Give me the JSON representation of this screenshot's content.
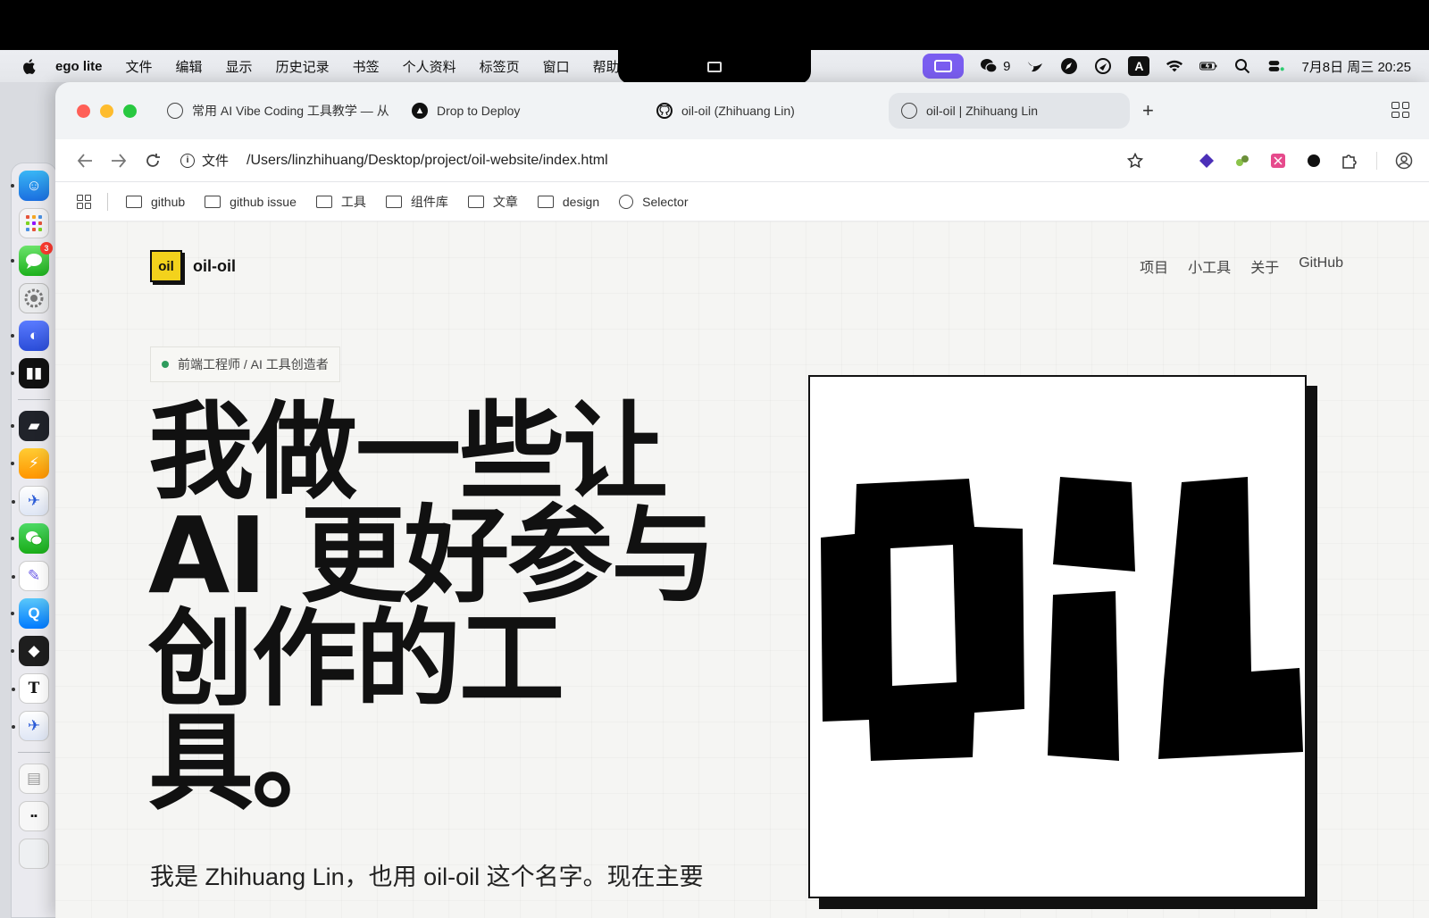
{
  "menubar": {
    "app": "ego lite",
    "items": [
      "文件",
      "编辑",
      "显示",
      "历史记录",
      "书签",
      "个人资料",
      "标签页",
      "窗口",
      "帮助"
    ],
    "status": {
      "wechat_count": "9",
      "input_method": "A",
      "datetime": "7月8日 周三 20:25"
    }
  },
  "tabs": [
    {
      "title": "常用 AI Vibe Coding 工具教学 — 从",
      "icon": "globe-icon"
    },
    {
      "title": "Drop to Deploy",
      "icon": "vercel-icon"
    },
    {
      "title": "oil-oil (Zhihuang Lin)",
      "icon": "github-icon"
    },
    {
      "title": "oil-oil | Zhihuang Lin",
      "icon": "globe-icon",
      "active": true
    }
  ],
  "toolbar": {
    "security_label": "文件",
    "url": "/Users/linzhihuang/Desktop/project/oil-website/index.html"
  },
  "bookmarks": [
    {
      "label": "github",
      "type": "folder"
    },
    {
      "label": "github issue",
      "type": "folder"
    },
    {
      "label": "工具",
      "type": "folder"
    },
    {
      "label": "组件库",
      "type": "folder"
    },
    {
      "label": "文章",
      "type": "folder"
    },
    {
      "label": "design",
      "type": "folder"
    },
    {
      "label": "Selector",
      "type": "globe"
    }
  ],
  "site": {
    "logo_mark": "oil",
    "logo_name": "oil-oil",
    "nav": [
      "项目",
      "小工具",
      "关于",
      "GitHub"
    ],
    "role": "前端工程师 / AI 工具创造者",
    "headline_lines": [
      "我做一些让",
      "AI 更好参与",
      "创作的工",
      "具。"
    ],
    "intro": "我是 Zhihuang Lin，也用 oil-oil 这个名字。现在主要",
    "hero_image_alt": "oiL"
  },
  "colors": {
    "accent_yellow": "#f3d21c",
    "status_green": "#2e9b5c",
    "traffic_red": "#ff5f57",
    "traffic_yellow": "#febc2e",
    "traffic_green": "#28c840"
  }
}
